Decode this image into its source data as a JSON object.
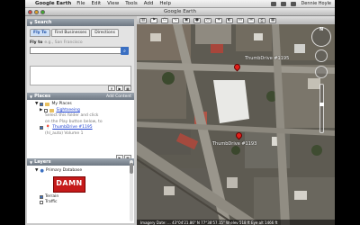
{
  "menubar": {
    "app": "Google Earth",
    "items": [
      "File",
      "Edit",
      "View",
      "Tools",
      "Add",
      "Help"
    ],
    "user": "Dennie Hoyle"
  },
  "window": {
    "title": "Google Earth"
  },
  "search": {
    "header": "Search",
    "tabs": [
      "Fly To",
      "Find Businesses",
      "Directions"
    ],
    "fly_to_label": "Fly to",
    "fly_to_placeholder": "e.g., San Francisco"
  },
  "places": {
    "header": "Places",
    "add_content": "Add Content",
    "my_places": "My Places",
    "sightseeing": "Sightseeing",
    "sightseeing_desc_1": "Select this folder and click",
    "sightseeing_desc_2": "on the Play button below, to",
    "thumbdrive": "ThumbDrive #1195",
    "thumbdrive_desc": "(hl_auto) Volume 1"
  },
  "layers": {
    "header": "Layers",
    "primary_database": "Primary Database",
    "logo_text": "DAMN",
    "terrain": "Terrain",
    "traffic": "Traffic"
  },
  "map": {
    "labels": [
      "ThumbDrive #1195",
      "ThumbDrive #1193"
    ],
    "north": "N",
    "status": "Imagery Date: ...    43°04'21.86\" N  77°38'57.15\" W  elev 518 ft      Eye alt 1466 ft"
  },
  "toolbar_icons": [
    "sidebar-icon",
    "placemark-icon",
    "polygon-icon",
    "path-icon",
    "overlay-icon",
    "tour-icon",
    "history-icon",
    "sun-icon",
    "planet-icon",
    "ruler-icon",
    "email-icon",
    "print-icon",
    "maps-icon"
  ]
}
